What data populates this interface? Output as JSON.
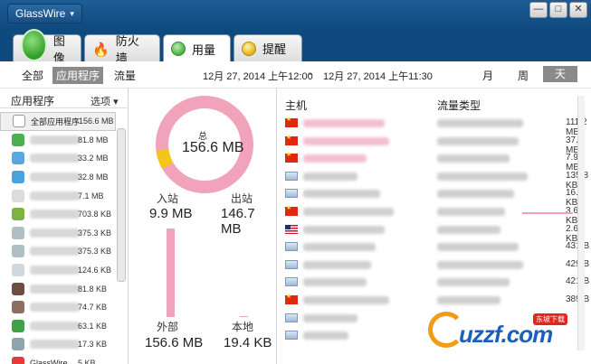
{
  "app": {
    "title": "GlassWire"
  },
  "window_controls": {
    "minimize": "—",
    "maximize": "□",
    "close": "✕"
  },
  "tabs": [
    {
      "label": "图像",
      "icon": "graph-icon"
    },
    {
      "label": "防火墙",
      "icon": "fire-icon"
    },
    {
      "label": "用量",
      "icon": "usage-icon",
      "active": true
    },
    {
      "label": "提醒",
      "icon": "alert-icon"
    }
  ],
  "filters": {
    "scope": [
      "全部",
      "应用程序",
      "流量"
    ],
    "selected_scope": "应用程序",
    "date_start": "12月 27, 2014 上午12:00",
    "date_sep": "-",
    "date_end": "12月 27, 2014 上午11:30",
    "periods": [
      "月",
      "周",
      "天"
    ],
    "selected_period": "天"
  },
  "app_list": {
    "title": "应用程序",
    "options_label": "选项",
    "options_caret": "▾",
    "items": [
      {
        "name": "全部应用程序",
        "size": "156.6 MB",
        "selected": true,
        "color": "#ffffff"
      },
      {
        "name": "",
        "size": "81.8 MB",
        "color": "#4caf50"
      },
      {
        "name": "",
        "size": "33.2 MB",
        "color": "#5aa7e0"
      },
      {
        "name": "",
        "size": "32.8 MB",
        "color": "#4aa3df"
      },
      {
        "name": "",
        "size": "7.1 MB",
        "color": "#dcdcdc"
      },
      {
        "name": "",
        "size": "703.8 KB",
        "color": "#7cb342"
      },
      {
        "name": "",
        "size": "375.3 KB",
        "color": "#b0bec5"
      },
      {
        "name": "",
        "size": "375.3 KB",
        "color": "#b0bec5"
      },
      {
        "name": "",
        "size": "124.6 KB",
        "color": "#cfd8dc"
      },
      {
        "name": "",
        "size": "81.8 KB",
        "color": "#6d4c41"
      },
      {
        "name": "",
        "size": "74.7 KB",
        "color": "#8d6e63"
      },
      {
        "name": "",
        "size": "63.1 KB",
        "color": "#43a047"
      },
      {
        "name": "",
        "size": "17.3 KB",
        "color": "#90a4ae"
      },
      {
        "name": "GlassWire",
        "size": "5 KB",
        "color": "#e53935"
      }
    ]
  },
  "summary": {
    "total_label": "总",
    "total_value": "156.6 MB",
    "incoming_label": "入站",
    "incoming_value": "9.9 MB",
    "outgoing_label": "出站",
    "outgoing_value": "146.7 MB",
    "external_label": "外部",
    "external_value": "156.6 MB",
    "local_label": "本地",
    "local_value": "19.4 KB",
    "incoming_fraction": 0.063,
    "external_fraction": 1.0,
    "colors": {
      "outgoing": "#f0a3ba",
      "incoming": "#f5c518",
      "track": "#f0a3ba"
    }
  },
  "hosts_table": {
    "host_header": "主机",
    "type_header": "流量类型",
    "rows": [
      {
        "flag": "cn",
        "size": "111.2 MB"
      },
      {
        "flag": "cn",
        "size": "37.4 MB"
      },
      {
        "flag": "cn",
        "size": "7.9 MB"
      },
      {
        "flag": "lan",
        "size": "135.8 KB"
      },
      {
        "flag": "lan",
        "size": "16.3 KB"
      },
      {
        "flag": "cn",
        "size": "3.6 KB"
      },
      {
        "flag": "us",
        "size": "2.6 KB"
      },
      {
        "flag": "lan",
        "size": "431 B"
      },
      {
        "flag": "lan",
        "size": "429 B"
      },
      {
        "flag": "lan",
        "size": "421 B"
      },
      {
        "flag": "cn",
        "size": "389 B"
      },
      {
        "flag": "lan",
        "size": ""
      },
      {
        "flag": "lan",
        "size": ""
      }
    ]
  },
  "watermark": {
    "text": "uzzf.com",
    "badge": "东坡下载"
  }
}
